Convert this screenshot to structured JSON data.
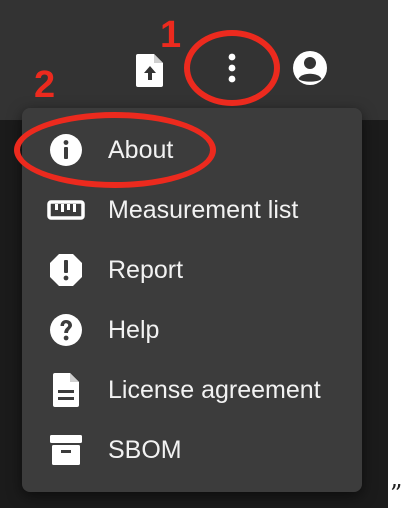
{
  "toolbar": {
    "icons": {
      "upload": "file-upload-icon",
      "more": "more-vert-icon",
      "account": "account-circle-icon"
    }
  },
  "menu": {
    "items": [
      {
        "label": "About",
        "icon": "info-icon"
      },
      {
        "label": "Measurement list",
        "icon": "ruler-icon"
      },
      {
        "label": "Report",
        "icon": "report-icon"
      },
      {
        "label": "Help",
        "icon": "help-icon"
      },
      {
        "label": "License agreement",
        "icon": "description-icon"
      },
      {
        "label": "SBOM",
        "icon": "archive-icon"
      }
    ]
  },
  "annotations": {
    "step1": "1",
    "step2": "2",
    "color": "#ec2a1e"
  },
  "trailing_text": "”"
}
